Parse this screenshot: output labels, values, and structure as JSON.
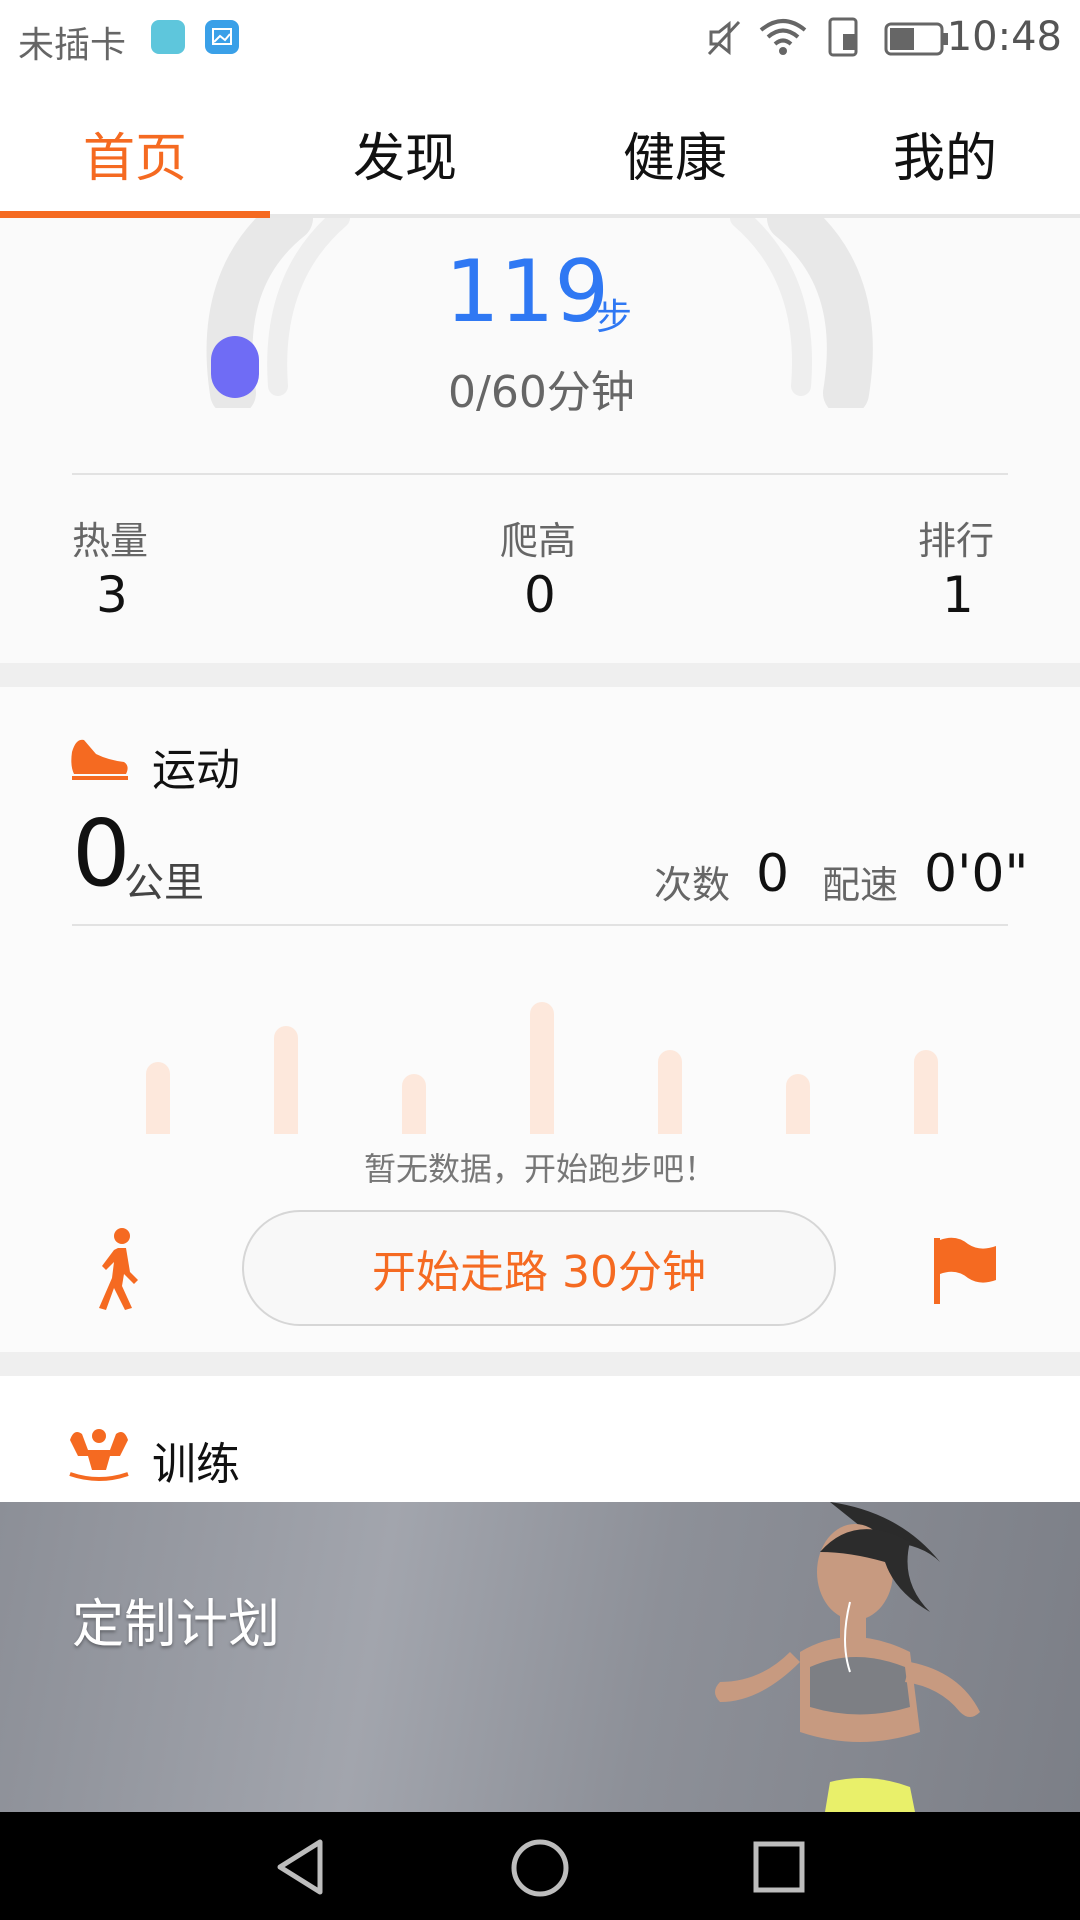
{
  "status_bar": {
    "carrier": "未插卡",
    "time": "10:48",
    "icons": [
      "emui-app-icon",
      "gallery-icon",
      "mute-icon",
      "wifi-icon",
      "sim-icon",
      "battery-icon"
    ]
  },
  "tabs": [
    {
      "label": "首页",
      "active": true
    },
    {
      "label": "发现",
      "active": false
    },
    {
      "label": "健康",
      "active": false
    },
    {
      "label": "我的",
      "active": false
    }
  ],
  "steps": {
    "value": "119",
    "unit": "步",
    "goal_text": "0/60分钟"
  },
  "stats": [
    {
      "label": "热量",
      "value": "3"
    },
    {
      "label": "爬高",
      "value": "0"
    },
    {
      "label": "排行",
      "value": "1"
    }
  ],
  "exercise": {
    "title": "运动",
    "distance_value": "0",
    "distance_unit": "公里",
    "count_label": "次数",
    "count_value": "0",
    "pace_label": "配速",
    "pace_value": "0'0\"",
    "chart_note": "暂无数据，开始跑步吧！",
    "start_button": "开始走路 30分钟"
  },
  "training": {
    "title": "训练",
    "banner_title": "定制计划"
  },
  "colors": {
    "accent": "#f56a21",
    "steps_blue": "#2f78f3",
    "progress_dot": "#6f6cf5"
  }
}
